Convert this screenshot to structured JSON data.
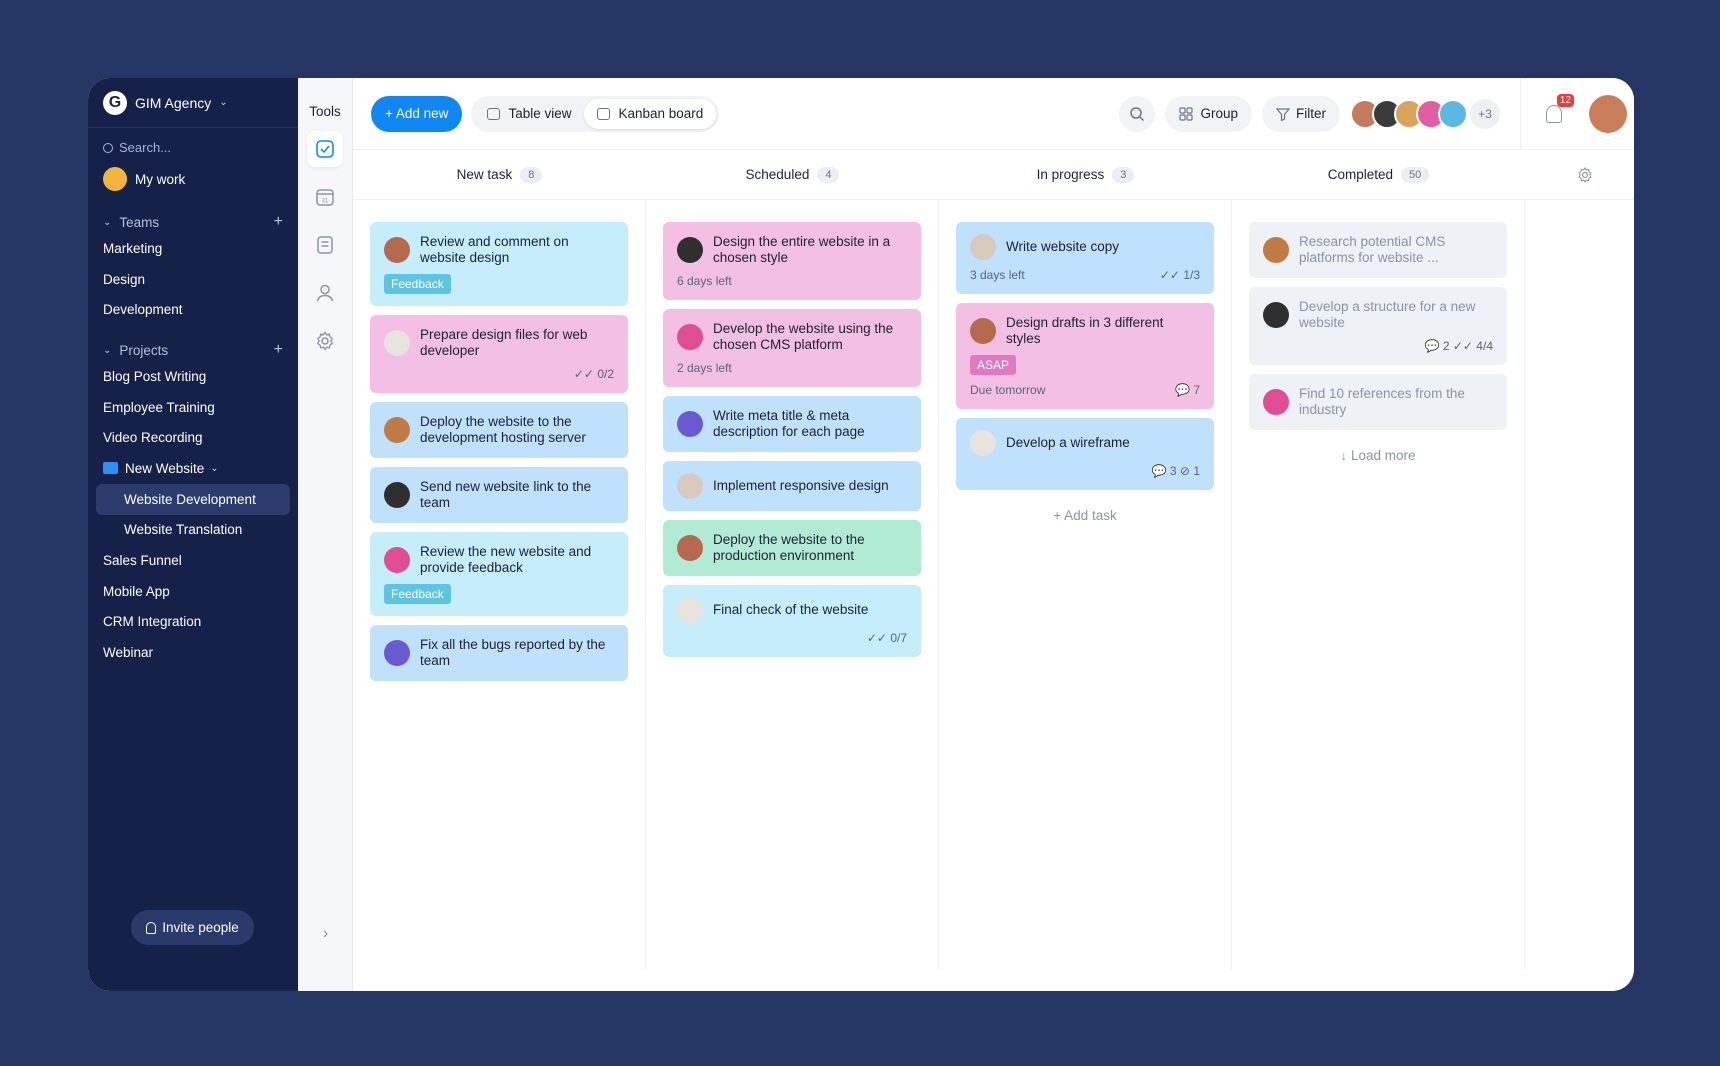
{
  "workspace": {
    "name": "GIM Agency"
  },
  "sidebar": {
    "search_placeholder": "Search...",
    "my_work": "My work",
    "teams_label": "Teams",
    "teams": [
      "Marketing",
      "Design",
      "Development"
    ],
    "projects_label": "Projects",
    "projects": [
      "Blog Post Writing",
      "Employee Training",
      "Video Recording"
    ],
    "project_folder": "New Website",
    "folder_items": [
      "Website Development",
      "Website Translation"
    ],
    "projects_after": [
      "Sales Funnel",
      "Mobile App",
      "CRM Integration",
      "Webinar"
    ],
    "invite": "Invite people"
  },
  "tools": {
    "title": "Tools"
  },
  "toolbar": {
    "add_new": "+ Add new",
    "table_view": "Table view",
    "kanban": "Kanban board",
    "group": "Group",
    "filter": "Filter",
    "more_members": "+3",
    "notifications": "12"
  },
  "columns": [
    {
      "title": "New task",
      "count": "8",
      "cards": [
        {
          "text": "Review and comment on website design",
          "color": "cyan",
          "tag": "Feedback"
        },
        {
          "text": "Prepare design files for web developer",
          "color": "pink",
          "right": "✓✓ 0/2"
        },
        {
          "text": "Deploy the website to the development hosting server",
          "color": "blue"
        },
        {
          "text": "Send new website link to the team",
          "color": "blue"
        },
        {
          "text": "Review the new website and provide feedback",
          "color": "cyan",
          "tag": "Feedback"
        },
        {
          "text": "Fix all the bugs reported by the team",
          "color": "blue"
        }
      ]
    },
    {
      "title": "Scheduled",
      "count": "4",
      "cards": [
        {
          "text": "Design the entire website in a chosen style",
          "color": "pink",
          "left": "6 days left"
        },
        {
          "text": "Develop the website using the chosen CMS platform",
          "color": "pink",
          "left": "2 days left"
        },
        {
          "text": "Write meta title & meta description for each page",
          "color": "blue"
        },
        {
          "text": "Implement responsive design",
          "color": "blue"
        },
        {
          "text": "Deploy the website to the production environment",
          "color": "green"
        },
        {
          "text": "Final check of the website",
          "color": "cyan",
          "right": "✓✓ 0/7"
        }
      ]
    },
    {
      "title": "In progress",
      "count": "3",
      "cards": [
        {
          "text": "Write website copy",
          "color": "blue",
          "left": "3 days left",
          "right": "✓✓ 1/3"
        },
        {
          "text": "Design drafts in 3 different styles",
          "color": "pink",
          "tag": "ASAP",
          "left": "Due tomorrow",
          "right": "💬 7"
        },
        {
          "text": "Develop a wireframe",
          "color": "blue",
          "right": "💬 3  ⊘ 1"
        }
      ],
      "add_task": "+ Add task"
    },
    {
      "title": "Completed",
      "count": "50",
      "cards": [
        {
          "text": "Research potential CMS platforms for website ...",
          "color": "gray"
        },
        {
          "text": "Develop a structure for a new website",
          "color": "gray",
          "right": "💬 2  ✓✓ 4/4"
        },
        {
          "text": "Find 10 references from the industry",
          "color": "gray"
        }
      ],
      "load_more": "↓ Load more"
    }
  ],
  "colors": {
    "accent": "#1187f4",
    "sidebar": "#152148",
    "background": "#263664"
  }
}
